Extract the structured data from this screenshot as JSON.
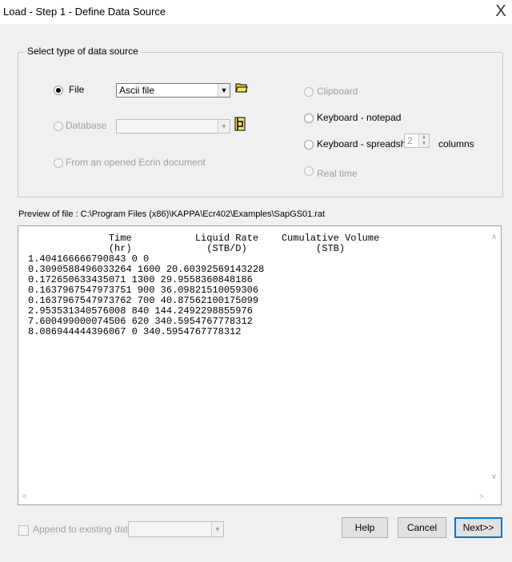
{
  "window": {
    "title": "Load - Step 1 - Define Data Source",
    "close_glyph": "X"
  },
  "group": {
    "legend": "Select type of data source"
  },
  "sources": {
    "file": {
      "label": "File",
      "checked": true,
      "combo_value": "Ascii file"
    },
    "database": {
      "label": "Database",
      "combo_value": ""
    },
    "ecrin": {
      "label": "From an opened Ecrin document"
    },
    "clipboard": {
      "label": "Clipboard"
    },
    "keyboard_notepad": {
      "label": "Keyboard - notepad"
    },
    "keyboard_spreadsheet": {
      "label": "Keyboard - spreadsheet",
      "columns_value": "2",
      "columns_label": "columns"
    },
    "realtime": {
      "label": "Real time"
    }
  },
  "preview": {
    "label": "Preview of file : C:\\Program Files (x86)\\KAPPA\\Ecr402\\Examples\\SapGS01.rat",
    "header1": "              Time           Liquid Rate    Cumulative Volume",
    "header2": "              (hr)             (STB/D)            (STB)",
    "rows": [
      "1.404166666790843 0 0",
      "0.3090588496033264 1600 20.60392569143228",
      "0.172650633435071 1300 29.9558360848186",
      "0.1637967547973751 900 36.09821510059306",
      "0.1637967547973762 700 40.87562100175099",
      "2.953531340576008 840 144.2492298855976",
      "7.600499000074506 620 340.5954767778312",
      "8.086944444396067 0 340.5954767778312"
    ]
  },
  "footer": {
    "append_label": "Append to existing data",
    "help_label": "Help",
    "cancel_label": "Cancel",
    "next_label": "Next>>"
  }
}
